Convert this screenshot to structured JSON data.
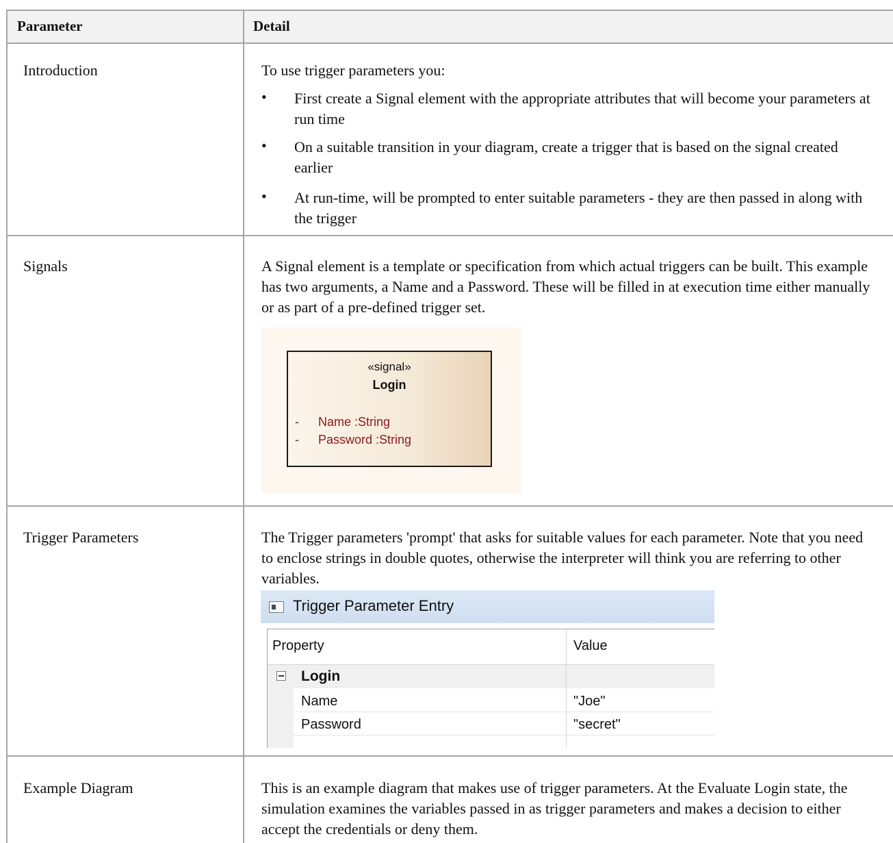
{
  "header": {
    "parameter": "Parameter",
    "detail": "Detail"
  },
  "rows": {
    "introduction": {
      "parameter": "Introduction",
      "intro": "To use trigger parameters you:",
      "bullets": [
        "First create a Signal element with the appropriate attributes that will become your parameters at run time",
        "On a suitable transition in your diagram, create a trigger that is based on the signal created earlier",
        "At run-time, will be prompted to enter suitable parameters - they are then passed in along with the trigger"
      ],
      "bullet_glyph": "•"
    },
    "signals": {
      "parameter": "Signals",
      "text": "A Signal element is a template or specification from which actual triggers can be built. This example has two arguments, a Name and a Password. These will be filled in at execution time either manually or as part of a pre-defined trigger set.",
      "figure": {
        "stereotype": "«signal»",
        "name": "Login",
        "attributes": [
          {
            "visibility": "-",
            "text": "Name  :String"
          },
          {
            "visibility": "-",
            "text": "Password  :String"
          }
        ],
        "attribute_color": "#8b1a1a"
      }
    },
    "trigger_parameters": {
      "parameter": "Trigger Parameters",
      "text": "The Trigger parameters 'prompt' that asks for suitable values for each parameter. Note that you need to enclose strings in double quotes, otherwise the interpreter will think you are referring to other variables.",
      "dialog": {
        "title": "Trigger Parameter Entry",
        "col_property": "Property",
        "col_value": "Value",
        "group": "Login",
        "items": [
          {
            "name": "Name",
            "value": "\"Joe\""
          },
          {
            "name": "Password",
            "value": "\"secret\""
          }
        ]
      }
    },
    "example_diagram": {
      "parameter": "Example Diagram",
      "text": "This is an example diagram that makes use of trigger parameters. At the Evaluate Login state, the simulation examines the variables passed in as trigger parameters and makes a decision to either accept the credentials or deny them."
    }
  }
}
